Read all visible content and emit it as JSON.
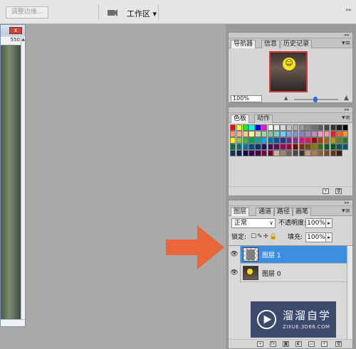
{
  "options_bar": {
    "refine_edge_label": "调整边缘...",
    "workspace_label": "工作区 ▾",
    "dock_collapse": "▸▸"
  },
  "document": {
    "ruler_mark": "550",
    "close_label": "x",
    "scroll_up": "▲",
    "scroll_down": "▼"
  },
  "navigator": {
    "tabs": [
      "导航器",
      "信息",
      "历史记录"
    ],
    "zoom": "100%",
    "menu": "▾≡"
  },
  "swatches_panel": {
    "tabs": [
      "色板",
      "动作"
    ],
    "menu": "▾≡",
    "colors": [
      "#ff0000",
      "#ffff00",
      "#00ff00",
      "#00ffff",
      "#0000ff",
      "#ff00ff",
      "#ffffff",
      "#ebebeb",
      "#d6d6d6",
      "#c2c2c2",
      "#adadad",
      "#999999",
      "#858585",
      "#707070",
      "#5c5c5c",
      "#474747",
      "#333333",
      "#1f1f1f",
      "#000000",
      "#f7977a",
      "#f9ad81",
      "#fdc68a",
      "#fff79a",
      "#c4df9b",
      "#a2d39c",
      "#82ca9d",
      "#7bcdc8",
      "#6ecff6",
      "#7ea7d8",
      "#8493ca",
      "#8882be",
      "#a187be",
      "#bc8dbf",
      "#f49ac2",
      "#f6989d",
      "#ed1c24",
      "#f26522",
      "#f7941d",
      "#fff200",
      "#8dc73f",
      "#39b54a",
      "#00a651",
      "#00a99d",
      "#00aeef",
      "#0072bc",
      "#0054a6",
      "#2e3192",
      "#662d91",
      "#92278f",
      "#ec008c",
      "#ed145b",
      "#9e0b0f",
      "#a0410d",
      "#a36209",
      "#aba000",
      "#598527",
      "#197b30",
      "#007236",
      "#00746b",
      "#0076a3",
      "#004a80",
      "#003471",
      "#1b1464",
      "#440e62",
      "#630460",
      "#9e005d",
      "#9e0039",
      "#790000",
      "#7b2e00",
      "#7d4900",
      "#827b00",
      "#406618",
      "#005e20",
      "#005826",
      "#005952",
      "#005b7f",
      "#003663",
      "#002157",
      "#0d004c",
      "#32004b",
      "#4b0049",
      "#7b0046",
      "#7a0026",
      "#c7b299",
      "#998675",
      "#736357",
      "#534741",
      "#37302d",
      "#c69c6d",
      "#a67c52",
      "#8c6239",
      "#754c24",
      "#603913",
      "#42210b"
    ],
    "footer_icons": [
      "new-swatch-icon",
      "trash-icon"
    ]
  },
  "layers_panel": {
    "tabs": [
      "图层",
      "通道",
      "路径",
      "画笔"
    ],
    "menu": "▾≡",
    "blend_mode": "正常",
    "opacity_label": "不透明度:",
    "opacity_value": "100%",
    "lock_label": "锁定:",
    "fill_label": "填充:",
    "fill_value": "100%",
    "layers": [
      {
        "name": "图层 1",
        "selected": true,
        "eye": "👁"
      },
      {
        "name": "图层 0",
        "selected": false,
        "eye": "👁"
      }
    ]
  },
  "annotation": {
    "arrow_color": "#e8663a"
  },
  "watermark": {
    "title": "溜溜自学",
    "url": "ZIXUE.3D66.COM"
  }
}
